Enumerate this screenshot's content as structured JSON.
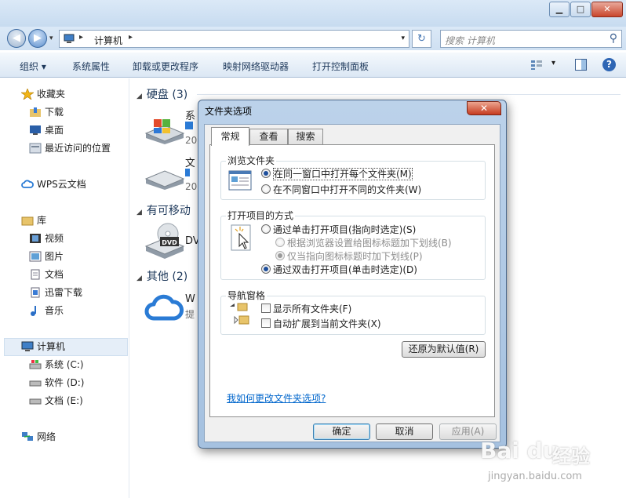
{
  "window": {
    "min_label": "▁",
    "max_label": "□",
    "close_label": "✕"
  },
  "nav": {
    "back": "◀",
    "forward": "▶",
    "dropdown": "▾",
    "address_sep1": "▸",
    "address_text": "计算机",
    "address_sep2": "▸",
    "address_drop": "▾",
    "refresh": "↻",
    "search_placeholder": "搜索 计算机",
    "search_glyph": "⚲"
  },
  "toolbar": {
    "organize": "组织 ▾",
    "sysprop": "系统属性",
    "uninstall": "卸载或更改程序",
    "map_drive": "映射网络驱动器",
    "control_panel": "打开控制面板",
    "view_drop": "▾",
    "help": "?"
  },
  "sidebar": {
    "favorites": "收藏夹",
    "downloads": "下载",
    "desktop": "桌面",
    "recent": "最近访问的位置",
    "wps": "WPS云文档",
    "libraries": "库",
    "videos": "视频",
    "pictures": "图片",
    "documents": "文档",
    "xunlei": "迅雷下载",
    "music": "音乐",
    "computer": "计算机",
    "drive_c": "系统 (C:)",
    "drive_d": "软件 (D:)",
    "drive_e": "文档 (E:)",
    "network": "网络"
  },
  "content": {
    "group_hdd": "硬盘 (3)",
    "group_removable": "有可移动",
    "group_other": "其他 (2)",
    "drive1_name": "系",
    "drive1_sub": "20",
    "drive2_name": "文",
    "drive2_sub": "20",
    "dvd_label": "DVD",
    "dvd_name": "DV",
    "wps_name": "W",
    "wps_sub": "提"
  },
  "dialog": {
    "title": "文件夹选项",
    "close": "✕",
    "tabs": [
      "常规",
      "查看",
      "搜索"
    ],
    "browse_group": "浏览文件夹",
    "browse_same": "在同一窗口中打开每个文件夹(M)",
    "browse_new": "在不同窗口中打开不同的文件夹(W)",
    "click_group": "打开项目的方式",
    "single_click": "通过单击打开项目(指向时选定)(S)",
    "underline_browser": "根据浏览器设置给图标标题加下划线(B)",
    "underline_point": "仅当指向图标标题时加下划线(P)",
    "double_click": "通过双击打开项目(单击时选定)(D)",
    "nav_group": "导航窗格",
    "show_all": "显示所有文件夹(F)",
    "auto_expand": "自动扩展到当前文件夹(X)",
    "restore": "还原为默认值(R)",
    "help_link": "我如何更改文件夹选项?",
    "ok": "确定",
    "cancel": "取消",
    "apply": "应用(A)"
  },
  "watermark": {
    "logo": "Bai du",
    "cn": "经验",
    "url": "jingyan.baidu.com"
  }
}
